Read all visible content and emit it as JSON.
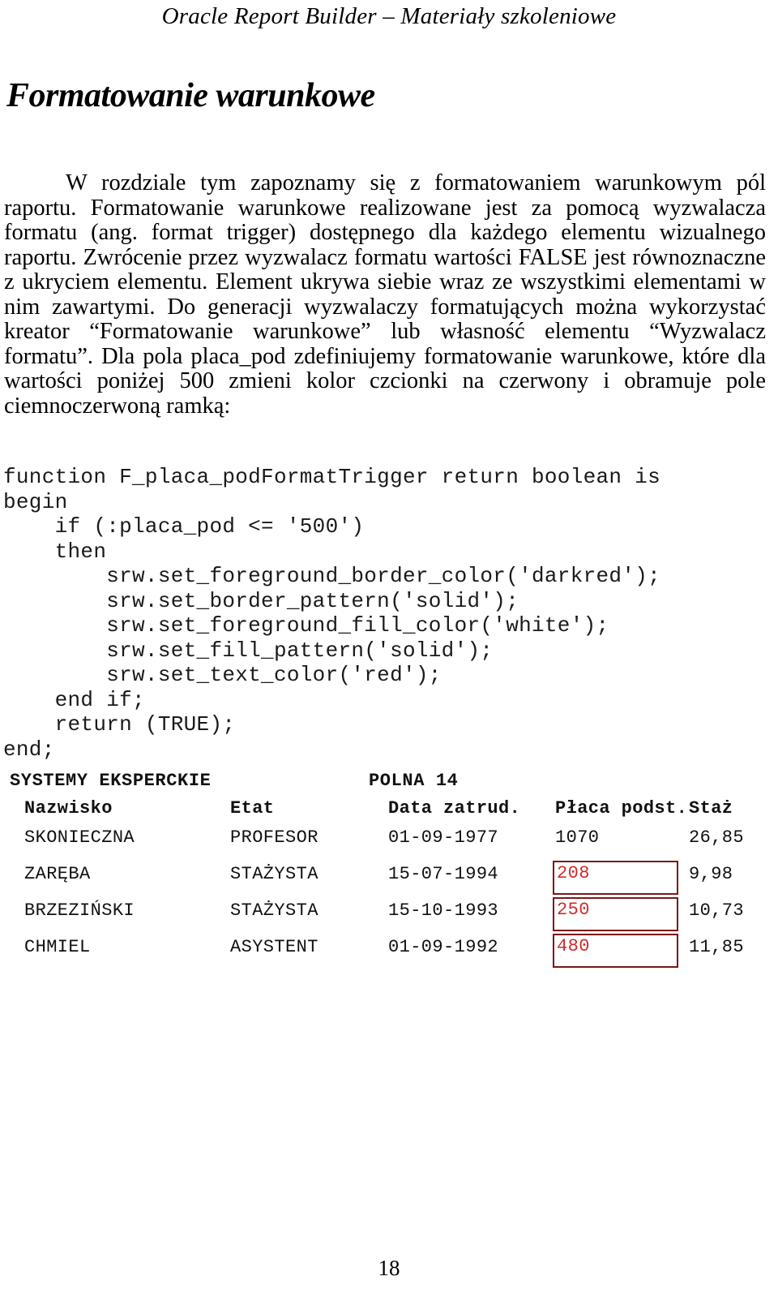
{
  "header": {
    "running_title": "Oracle Report Builder – Materiały szkoleniowe"
  },
  "chapter": {
    "title": "Formatowanie warunkowe"
  },
  "body": {
    "paragraph": "W rozdziale tym zapoznamy się z formatowaniem warunkowym pól raportu. Formatowanie warunkowe realizowane jest za pomocą wyzwalacza formatu (ang. format trigger) dostępnego dla każdego elementu wizualnego raportu. Zwrócenie przez wyzwalacz formatu wartości FALSE jest równoznaczne z ukryciem elementu. Element ukrywa siebie wraz ze wszystkimi elementami w nim zawartymi. Do generacji wyzwalaczy formatujących można wykorzystać kreator “Formatowanie warunkowe” lub własność elementu “Wyzwalacz formatu”. Dla pola placa_pod zdefiniujemy formatowanie warunkowe, które dla wartości poniżej 500 zmieni kolor czcionki na czerwony i obramuje pole ciemnoczerwoną ramką:"
  },
  "code": {
    "listing": "function F_placa_podFormatTrigger return boolean is\nbegin\n    if (:placa_pod <= '500')\n    then\n        srw.set_foreground_border_color('darkred');\n        srw.set_border_pattern('solid');\n        srw.set_foreground_fill_color('white');\n        srw.set_fill_pattern('solid');\n        srw.set_text_color('red');\n    end if;\n    return (TRUE);\nend;"
  },
  "report": {
    "company": "SYSTEMY EKSPERCKIE",
    "address": "POLNA 14",
    "columns": {
      "nazwisko": "Nazwisko",
      "etat": "Etat",
      "data_zatrud": "Data zatrud.",
      "placa_podst": "Płaca podst.",
      "staz": "Staż"
    },
    "rows": [
      {
        "nazwisko": "SKONIECZNA",
        "etat": "PROFESOR",
        "data_zatrud": "01-09-1977",
        "placa_podst": "1070",
        "staz": "26,85",
        "highlighted": false
      },
      {
        "nazwisko": "ZARĘBA",
        "etat": "STAŻYSTA",
        "data_zatrud": "15-07-1994",
        "placa_podst": "208",
        "staz": "9,98",
        "highlighted": true
      },
      {
        "nazwisko": "BRZEZIŃSKI",
        "etat": "STAŻYSTA",
        "data_zatrud": "15-10-1993",
        "placa_podst": "250",
        "staz": "10,73",
        "highlighted": true
      },
      {
        "nazwisko": "CHMIEL",
        "etat": "ASYSTENT",
        "data_zatrud": "01-09-1992",
        "placa_podst": "480",
        "staz": "11,85",
        "highlighted": true
      }
    ],
    "highlight_colors": {
      "text": "#d02b2b",
      "border": "#7b1818",
      "fill": "#ffffff"
    }
  },
  "footer": {
    "page_number": "18"
  }
}
